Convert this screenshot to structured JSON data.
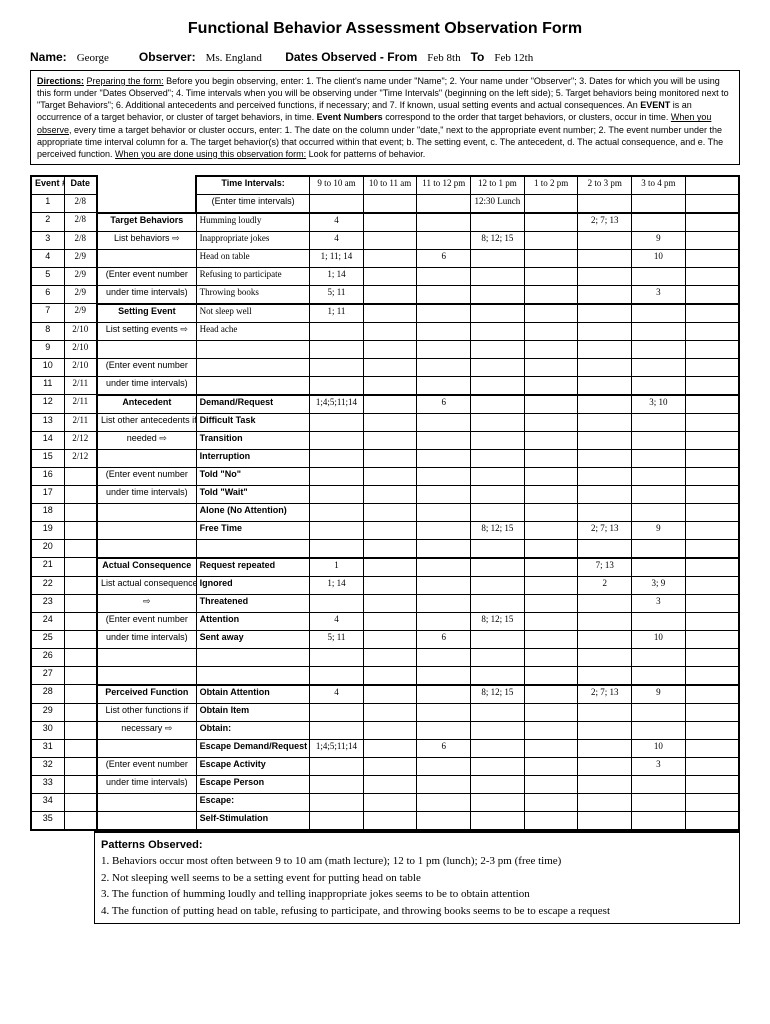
{
  "title": "Functional Behavior Assessment Observation Form",
  "header": {
    "name_label": "Name:",
    "name": "George",
    "observer_label": "Observer:",
    "observer": "Ms. England",
    "dates_label": "Dates Observed - From",
    "date_from": "Feb 8th",
    "to_label": "To",
    "date_to": "Feb 12th"
  },
  "directions_label": "Directions:",
  "directions_prep": "Preparing the form:",
  "directions_body1": " Before you begin observing, enter: 1. The client's name under \"Name\"; 2. Your name under \"Observer\"; 3. Dates for which you will be using this form under \"Dates Observed\"; 4. Time intervals when you will be observing under \"Time Intervals\" (beginning on the left side); 5. Target behaviors being monitored next to \"Target Behaviors\"; 6. Additional antecedents and perceived functions, if necessary; and 7. If known, usual setting events and actual consequences. An ",
  "directions_event": "EVENT",
  "directions_body2": " is an occurrence of a target behavior, or cluster of target behaviors, in time. ",
  "directions_eventnum": "Event Numbers",
  "directions_body3": " correspond to the order that target behaviors, or clusters, occur in time. ",
  "directions_when": "When you observe,",
  "directions_body4": " every time a target behavior or cluster occurs, enter: 1. The date on the column under \"date,\" next to the appropriate event number; 2. The event number under the appropriate time interval column for a. The target behavior(s) that occurred within that event; b. The setting event, c. The antecedent, d. The actual consequence, and e. The perceived function. ",
  "directions_done": "When you are done using this observation form:",
  "directions_body5": " Look for patterns of behavior.",
  "cols": {
    "event": "Event #",
    "date": "Date",
    "time_intervals": "Time Intervals:",
    "enter_time": "(Enter time intervals)",
    "intervals": [
      "9 to 10 am",
      "10 to 11 am",
      "11 to 12 pm",
      "12 to 1 pm",
      "1 to 2 pm",
      "2 to 3 pm",
      "3 to 4 pm",
      ""
    ],
    "interval_sub": [
      "",
      "",
      "",
      "12:30 Lunch",
      "",
      "",
      "",
      ""
    ]
  },
  "events": [
    {
      "n": "1",
      "d": "2/8"
    },
    {
      "n": "2",
      "d": "2/8"
    },
    {
      "n": "3",
      "d": "2/8"
    },
    {
      "n": "4",
      "d": "2/9"
    },
    {
      "n": "5",
      "d": "2/9"
    },
    {
      "n": "6",
      "d": "2/9"
    },
    {
      "n": "7",
      "d": "2/9"
    },
    {
      "n": "8",
      "d": "2/10"
    },
    {
      "n": "9",
      "d": "2/10"
    },
    {
      "n": "10",
      "d": "2/10"
    },
    {
      "n": "11",
      "d": "2/11"
    },
    {
      "n": "12",
      "d": "2/11"
    },
    {
      "n": "13",
      "d": "2/11"
    },
    {
      "n": "14",
      "d": "2/12"
    },
    {
      "n": "15",
      "d": "2/12"
    },
    {
      "n": "16",
      "d": ""
    },
    {
      "n": "17",
      "d": ""
    },
    {
      "n": "18",
      "d": ""
    },
    {
      "n": "19",
      "d": ""
    },
    {
      "n": "20",
      "d": ""
    },
    {
      "n": "21",
      "d": ""
    },
    {
      "n": "22",
      "d": ""
    },
    {
      "n": "23",
      "d": ""
    },
    {
      "n": "24",
      "d": ""
    },
    {
      "n": "25",
      "d": ""
    },
    {
      "n": "26",
      "d": ""
    },
    {
      "n": "27",
      "d": ""
    },
    {
      "n": "28",
      "d": ""
    },
    {
      "n": "29",
      "d": ""
    },
    {
      "n": "30",
      "d": ""
    },
    {
      "n": "31",
      "d": ""
    },
    {
      "n": "32",
      "d": ""
    },
    {
      "n": "33",
      "d": ""
    },
    {
      "n": "34",
      "d": ""
    },
    {
      "n": "35",
      "d": ""
    }
  ],
  "sections": [
    {
      "title": "Target Behaviors",
      "hints": [
        "List behaviors",
        "",
        "(Enter event number",
        "under time intervals)"
      ]
    },
    {
      "title": "Setting Event",
      "hints": [
        "List setting events",
        "",
        "(Enter event number",
        "under time intervals)"
      ]
    },
    {
      "title": "Antecedent",
      "hints": [
        "List other antecedents if",
        "needed",
        "",
        "(Enter event number",
        "under time intervals)",
        "",
        ""
      ]
    },
    {
      "title": "Actual Consequence",
      "hints": [
        "List actual consequences",
        "",
        "(Enter event number",
        "under time intervals)",
        "",
        ""
      ]
    },
    {
      "title": "Perceived Function",
      "hints": [
        "List other functions if",
        "necessary",
        "",
        "(Enter event number",
        "under time intervals)",
        "",
        ""
      ]
    }
  ],
  "rows": [
    {
      "sec": 0,
      "desc": "Humming loudly",
      "v": [
        "4",
        "",
        "",
        "",
        "",
        "2; 7; 13",
        "",
        ""
      ]
    },
    {
      "sec": 0,
      "desc": "Inappropriate jokes",
      "v": [
        "4",
        "",
        "",
        "8; 12; 15",
        "",
        "",
        "9",
        ""
      ]
    },
    {
      "sec": 0,
      "desc": "Head on table",
      "v": [
        "1; 11; 14",
        "",
        "6",
        "",
        "",
        "",
        "10",
        ""
      ]
    },
    {
      "sec": 0,
      "desc": "Refusing to participate",
      "v": [
        "1; 14",
        "",
        "",
        "",
        "",
        "",
        "",
        ""
      ]
    },
    {
      "sec": 0,
      "desc": "Throwing books",
      "v": [
        "5; 11",
        "",
        "",
        "",
        "",
        "",
        "3",
        ""
      ]
    },
    {
      "sec": 1,
      "desc": "Not sleep well",
      "v": [
        "1; 11",
        "",
        "",
        "",
        "",
        "",
        "",
        ""
      ]
    },
    {
      "sec": 1,
      "desc": "Head ache",
      "v": [
        "",
        "",
        "",
        "",
        "",
        "",
        "",
        ""
      ]
    },
    {
      "sec": 1,
      "desc": "",
      "v": [
        "",
        "",
        "",
        "",
        "",
        "",
        "",
        ""
      ]
    },
    {
      "sec": 1,
      "desc": "",
      "v": [
        "",
        "",
        "",
        "",
        "",
        "",
        "",
        ""
      ]
    },
    {
      "sec": 1,
      "desc": "",
      "v": [
        "",
        "",
        "",
        "",
        "",
        "",
        "",
        ""
      ]
    },
    {
      "sec": 2,
      "desc": "Demand/Request",
      "v": [
        "1;4;5;11;14",
        "",
        "6",
        "",
        "",
        "",
        "3; 10",
        ""
      ]
    },
    {
      "sec": 2,
      "desc": "Difficult Task",
      "v": [
        "",
        "",
        "",
        "",
        "",
        "",
        "",
        ""
      ]
    },
    {
      "sec": 2,
      "desc": "Transition",
      "v": [
        "",
        "",
        "",
        "",
        "",
        "",
        "",
        ""
      ]
    },
    {
      "sec": 2,
      "desc": "Interruption",
      "v": [
        "",
        "",
        "",
        "",
        "",
        "",
        "",
        ""
      ]
    },
    {
      "sec": 2,
      "desc": "Told \"No\"",
      "v": [
        "",
        "",
        "",
        "",
        "",
        "",
        "",
        ""
      ]
    },
    {
      "sec": 2,
      "desc": "Told \"Wait\"",
      "v": [
        "",
        "",
        "",
        "",
        "",
        "",
        "",
        ""
      ]
    },
    {
      "sec": 2,
      "desc": "Alone (No Attention)",
      "v": [
        "",
        "",
        "",
        "",
        "",
        "",
        "",
        ""
      ]
    },
    {
      "sec": 2,
      "desc": "Free Time",
      "v": [
        "",
        "",
        "",
        "8; 12; 15",
        "",
        "2; 7; 13",
        "9",
        ""
      ]
    },
    {
      "sec": 2,
      "desc": "",
      "v": [
        "",
        "",
        "",
        "",
        "",
        "",
        "",
        ""
      ]
    },
    {
      "sec": 3,
      "desc": "Request repeated",
      "v": [
        "1",
        "",
        "",
        "",
        "",
        "7; 13",
        "",
        ""
      ]
    },
    {
      "sec": 3,
      "desc": "Ignored",
      "v": [
        "1; 14",
        "",
        "",
        "",
        "",
        "2",
        "3; 9",
        ""
      ]
    },
    {
      "sec": 3,
      "desc": "Threatened",
      "v": [
        "",
        "",
        "",
        "",
        "",
        "",
        "3",
        ""
      ]
    },
    {
      "sec": 3,
      "desc": "Attention",
      "v": [
        "4",
        "",
        "",
        "8; 12; 15",
        "",
        "",
        "",
        ""
      ]
    },
    {
      "sec": 3,
      "desc": "Sent away",
      "v": [
        "5; 11",
        "",
        "6",
        "",
        "",
        "",
        "10",
        ""
      ]
    },
    {
      "sec": 3,
      "desc": "",
      "v": [
        "",
        "",
        "",
        "",
        "",
        "",
        "",
        ""
      ]
    },
    {
      "sec": 3,
      "desc": "",
      "v": [
        "",
        "",
        "",
        "",
        "",
        "",
        "",
        ""
      ]
    },
    {
      "sec": 4,
      "desc": "Obtain Attention",
      "v": [
        "4",
        "",
        "",
        "8; 12; 15",
        "",
        "2; 7; 13",
        "9",
        ""
      ]
    },
    {
      "sec": 4,
      "desc": "Obtain Item",
      "v": [
        "",
        "",
        "",
        "",
        "",
        "",
        "",
        ""
      ]
    },
    {
      "sec": 4,
      "desc": "Obtain:",
      "v": [
        "",
        "",
        "",
        "",
        "",
        "",
        "",
        ""
      ]
    },
    {
      "sec": 4,
      "desc": "Escape Demand/Request",
      "v": [
        "1;4;5;11;14",
        "",
        "6",
        "",
        "",
        "",
        "10",
        ""
      ]
    },
    {
      "sec": 4,
      "desc": "Escape Activity",
      "v": [
        "",
        "",
        "",
        "",
        "",
        "",
        "3",
        ""
      ]
    },
    {
      "sec": 4,
      "desc": "Escape Person",
      "v": [
        "",
        "",
        "",
        "",
        "",
        "",
        "",
        ""
      ]
    },
    {
      "sec": 4,
      "desc": "Escape:",
      "v": [
        "",
        "",
        "",
        "",
        "",
        "",
        "",
        ""
      ]
    },
    {
      "sec": 4,
      "desc": "Self-Stimulation",
      "v": [
        "",
        "",
        "",
        "",
        "",
        "",
        "",
        ""
      ]
    }
  ],
  "patterns_label": "Patterns Observed:",
  "patterns": [
    "1. Behaviors occur most often between 9 to 10 am (math lecture); 12 to 1 pm (lunch); 2-3 pm (free time)",
    "2. Not sleeping well seems to be a setting event for putting head on table",
    "3. The function of humming loudly and telling inappropriate jokes seems to be to obtain attention",
    "4. The function of putting head on table, refusing to participate, and throwing books seems to be to escape a request"
  ]
}
